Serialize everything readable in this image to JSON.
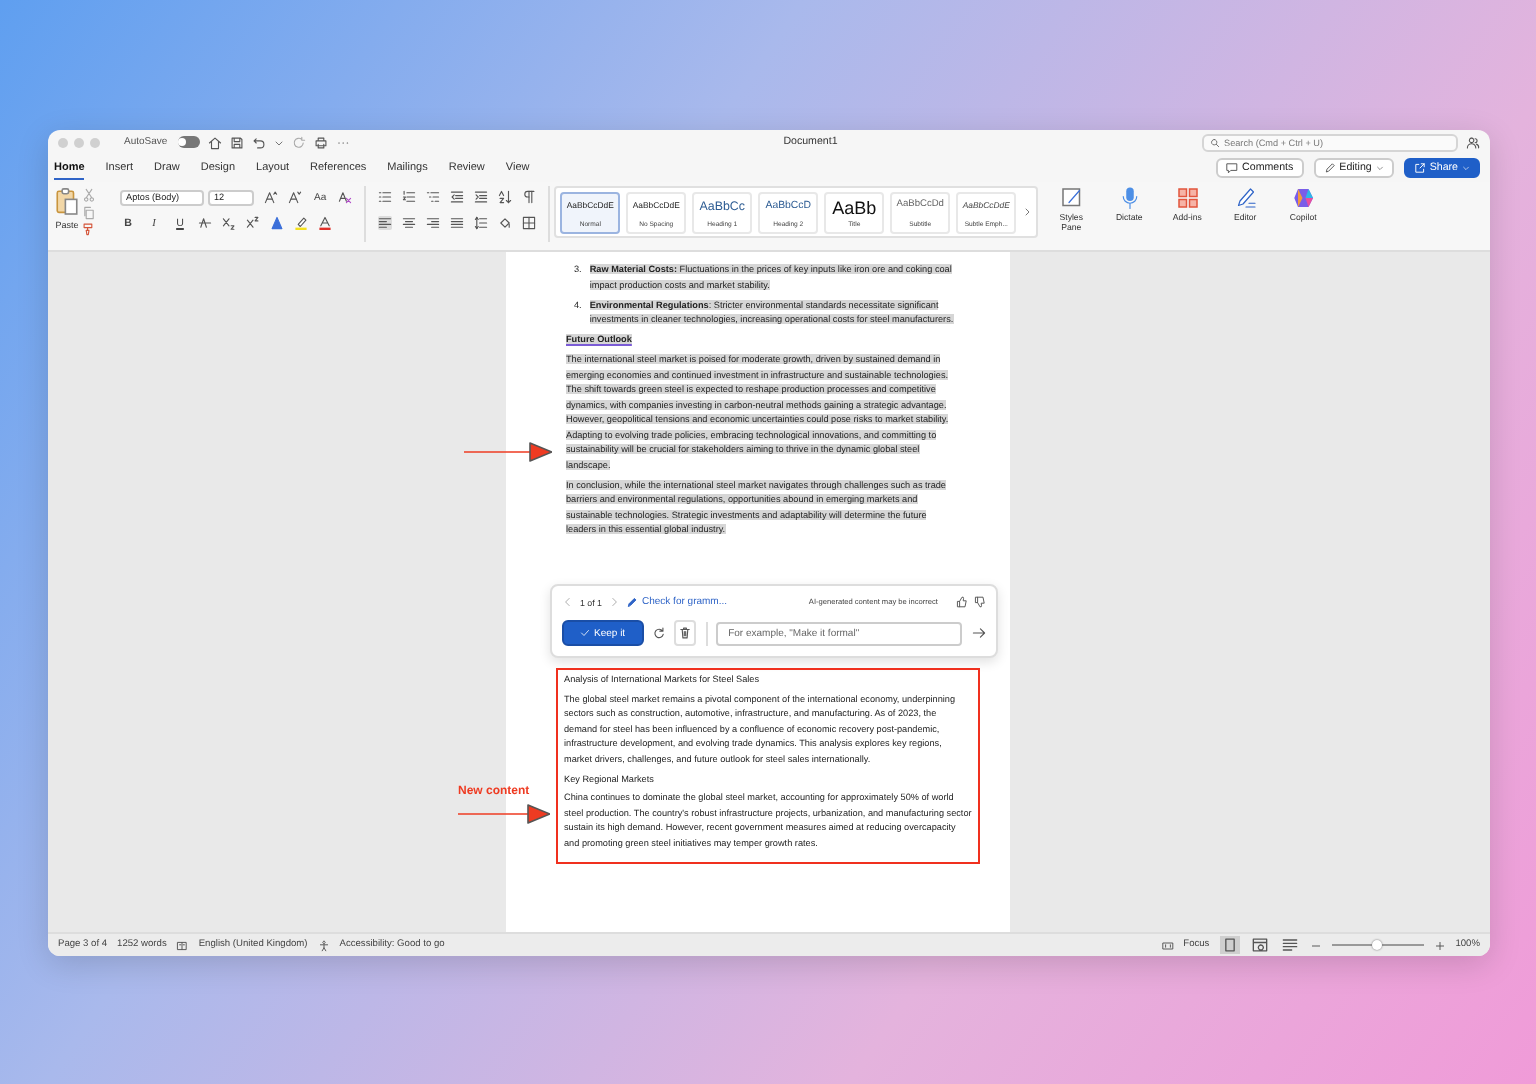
{
  "window": {
    "title": "Document1",
    "autosave": {
      "label": "AutoSave",
      "on": false
    },
    "search": {
      "placeholder": "Search (Cmd + Ctrl + U)"
    }
  },
  "tabs": [
    {
      "label": "Home",
      "selected": true
    },
    {
      "label": "Insert",
      "selected": false
    },
    {
      "label": "Draw",
      "selected": false
    },
    {
      "label": "Design",
      "selected": false
    },
    {
      "label": "Layout",
      "selected": false
    },
    {
      "label": "References",
      "selected": false
    },
    {
      "label": "Mailings",
      "selected": false
    },
    {
      "label": "Review",
      "selected": false
    },
    {
      "label": "View",
      "selected": false
    }
  ],
  "header_buttons": [
    {
      "label": "Comments",
      "kind": "comments"
    },
    {
      "label": "Editing",
      "kind": "editing"
    },
    {
      "label": "Share",
      "kind": "share"
    }
  ],
  "ribbon": {
    "paste_label": "Paste",
    "font": "Aptos (Body)",
    "font_size": "12",
    "change_case": "Aa",
    "text_buttons": [
      "B",
      "I",
      "U"
    ],
    "styles": [
      {
        "sample": "AaBbCcDdE",
        "name": "Normal",
        "selected": true
      },
      {
        "sample": "AaBbCcDdE",
        "name": "No Spacing",
        "selected": false
      },
      {
        "sample": "AaBbCc",
        "name": "Heading 1",
        "selected": false
      },
      {
        "sample": "AaBbCcD",
        "name": "Heading 2",
        "selected": false
      },
      {
        "sample": "AaBb",
        "name": "Title",
        "selected": false
      },
      {
        "sample": "AaBbCcDd",
        "name": "Subtitle",
        "selected": false
      },
      {
        "sample": "AaBbCcDdE",
        "name": "Subtle Emph...",
        "selected": false
      }
    ],
    "tools": [
      {
        "label": "Styles Pane",
        "kind": "styles"
      },
      {
        "label": "Dictate",
        "kind": "dictate"
      },
      {
        "label": "Add-ins",
        "kind": "addins"
      },
      {
        "label": "Editor",
        "kind": "editor"
      },
      {
        "label": "Copilot",
        "kind": "copilot"
      }
    ]
  },
  "document": {
    "blocks": [
      {
        "kind": "item",
        "number": "3.",
        "text": "**Raw Material Costs:** Fluctuations in the prices of key inputs like iron ore and coking coal impact production costs and market stability.",
        "highlighted": true
      },
      {
        "kind": "item",
        "number": "4.",
        "text": "**Environmental Regulations**: Stricter environmental standards necessitate significant investments in cleaner technologies, increasing operational costs for steel manufacturers.",
        "highlighted": true
      },
      {
        "kind": "heading",
        "text": "Future Outlook",
        "highlighted": true
      },
      {
        "kind": "paragraph",
        "text": "The international steel market is poised for moderate growth, driven by sustained demand in emerging economies and continued investment in infrastructure and sustainable technologies. The shift towards green steel is expected to reshape production processes and competitive dynamics, with companies investing in carbon-neutral methods gaining a strategic advantage. However, geopolitical tensions and economic uncertainties could pose risks to market stability. Adapting to evolving trade policies, embracing technological innovations, and committing to sustainability will be crucial for stakeholders aiming to thrive in the dynamic global steel landscape.",
        "highlighted": true
      },
      {
        "kind": "paragraph",
        "text": "In conclusion, while the international steel market navigates through challenges such as trade barriers and environmental regulations, opportunities abound in emerging markets and sustainable technologies. Strategic investments and adaptability will determine the future leaders in this essential global industry.",
        "highlighted": true
      }
    ],
    "new_content": [
      {
        "kind": "title",
        "text": "Analysis of International Markets for Steel Sales"
      },
      {
        "kind": "paragraph",
        "text": "The global steel market remains a pivotal component of the international economy, underpinning sectors such as construction, automotive, infrastructure, and manufacturing. As of 2023, the demand for steel has been influenced by a confluence of economic recovery post-pandemic, infrastructure development, and evolving trade dynamics. This analysis explores key regions, market drivers, challenges, and future outlook for steel sales internationally."
      },
      {
        "kind": "title",
        "text": "Key Regional Markets"
      },
      {
        "kind": "paragraph",
        "text": "China continues to dominate the global steel market, accounting for approximately 50% of world steel production. The country's robust infrastructure projects, urbanization, and manufacturing sector sustain its high demand. However, recent government measures aimed at reducing overcapacity and promoting green steel initiatives may temper growth rates."
      }
    ]
  },
  "copilot_popup": {
    "counter": "1 of 1",
    "prompt_label": "Check for gramm...",
    "disclaimer": "AI-generated content may be incorrect",
    "keep_button": "Keep it",
    "input": {
      "placeholder": "For example, \"Make it formal\""
    }
  },
  "annotation": {
    "label": "New content"
  },
  "status_bar": {
    "page": "Page 3 of 4",
    "words": "1252 words",
    "language": "English (United Kingdom)",
    "accessibility": "Accessibility: Good to go",
    "focus": "Focus",
    "views": [
      {
        "kind": "print",
        "selected": true
      },
      {
        "kind": "web",
        "selected": false
      },
      {
        "kind": "draft",
        "selected": false
      }
    ],
    "zoom": {
      "level": 0.5,
      "label": "100%"
    }
  }
}
